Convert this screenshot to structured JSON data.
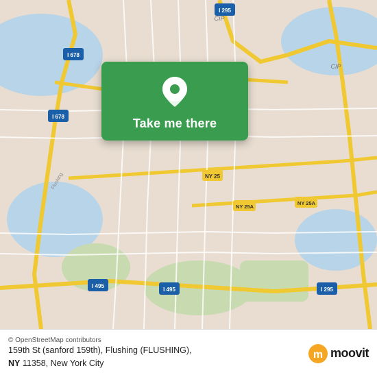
{
  "map": {
    "background_color": "#e8ddd0",
    "accent_green": "#3a9c4e"
  },
  "card": {
    "button_label": "Take me there",
    "pin_icon": "location-pin-icon"
  },
  "bottom_bar": {
    "copyright": "© OpenStreetMap contributors",
    "address_line1": "159th St (sanford 159th), Flushing (FLUSHING),",
    "address_line2": "<B>NY</B> 11358, New York City",
    "logo_text": "moovit"
  }
}
